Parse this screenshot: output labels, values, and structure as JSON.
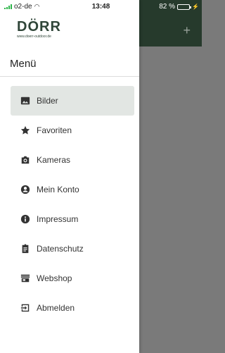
{
  "status_bar": {
    "carrier": "o2-de",
    "time": "13:48",
    "battery": "82 %",
    "battery_level": 0.82,
    "battery_color": "#2db54a"
  },
  "brand": {
    "name": "DÖRR",
    "url": "www.doerr-outdoor.de",
    "color": "#2f4538"
  },
  "header": {
    "add_symbol": "+"
  },
  "drawer": {
    "title": "Menü",
    "items": [
      {
        "label": "Bilder",
        "icon": "image-icon",
        "active": true
      },
      {
        "label": "Favoriten",
        "icon": "star-icon",
        "active": false
      },
      {
        "label": "Kameras",
        "icon": "camera-icon",
        "active": false
      },
      {
        "label": "Mein Konto",
        "icon": "account-icon",
        "active": false
      },
      {
        "label": "Impressum",
        "icon": "info-icon",
        "active": false
      },
      {
        "label": "Datenschutz",
        "icon": "clipboard-icon",
        "active": false
      },
      {
        "label": "Webshop",
        "icon": "store-icon",
        "active": false
      },
      {
        "label": "Abmelden",
        "icon": "logout-icon",
        "active": false
      }
    ]
  }
}
